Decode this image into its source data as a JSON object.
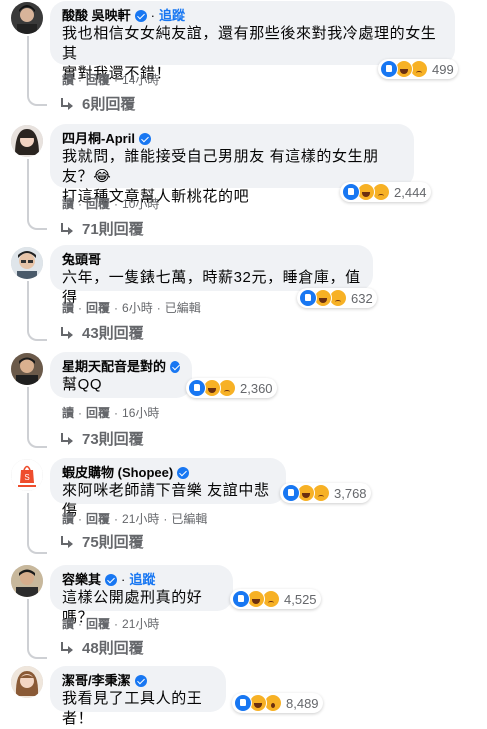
{
  "comments": [
    {
      "author": "酸酸 吳映軒",
      "follow_label": "追蹤",
      "text": [
        "我也相信女女純友誼，還有那些後來對我冷處理的女生其",
        "實對我還不錯！"
      ],
      "reactions": [
        "like",
        "haha",
        "sad"
      ],
      "reaction_count": "499",
      "actions": [
        "讀",
        "回覆",
        "14小時"
      ],
      "replies": "6則回覆"
    },
    {
      "author": "四月桐-April",
      "verified": true,
      "text": [
        "我就問，誰能接受自己男朋友 有這樣的女生朋友？😂",
        "打這種文章幫人斬桃花的吧"
      ],
      "reactions": [
        "like",
        "haha",
        "sad"
      ],
      "reaction_count": "2,444",
      "actions": [
        "讀",
        "回覆",
        "10小時"
      ],
      "replies": "71則回覆"
    },
    {
      "author": "兔頭哥",
      "text": [
        "六年，一隻錶七萬，時薪32元，睡倉庫，值得"
      ],
      "reactions": [
        "like",
        "haha",
        "sad"
      ],
      "reaction_count": "632",
      "actions": [
        "讀",
        "回覆",
        "6小時",
        "已編輯"
      ],
      "replies": "43則回覆"
    },
    {
      "author": "星期天配音是對的",
      "verified": true,
      "text": [
        "幫QQ"
      ],
      "reactions": [
        "like",
        "haha",
        "sad"
      ],
      "reaction_count": "2,360",
      "actions": [
        "讀",
        "回覆",
        "16小時"
      ],
      "replies": "73則回覆"
    },
    {
      "author": "蝦皮購物 (Shopee)",
      "verified": true,
      "text": [
        "來阿咪老師請下音樂 友誼中悲傷"
      ],
      "reactions": [
        "like",
        "haha",
        "sad"
      ],
      "reaction_count": "3,768",
      "actions": [
        "讀",
        "回覆",
        "21小時",
        "已編輯"
      ],
      "replies": "75則回覆"
    },
    {
      "author": "容樂其",
      "verified": true,
      "follow_label": "追蹤",
      "text": [
        "這樣公開處刑真的好嗎？"
      ],
      "reactions": [
        "like",
        "haha",
        "sad"
      ],
      "reaction_count": "4,525",
      "actions": [
        "讀",
        "回覆",
        "21小時"
      ],
      "replies": "48則回覆"
    },
    {
      "author": "潔哥/李秉潔",
      "verified": true,
      "text": [
        "我看見了工具人的王者！"
      ],
      "reactions": [
        "like",
        "haha",
        "wow"
      ],
      "reaction_count": "8,489"
    }
  ]
}
